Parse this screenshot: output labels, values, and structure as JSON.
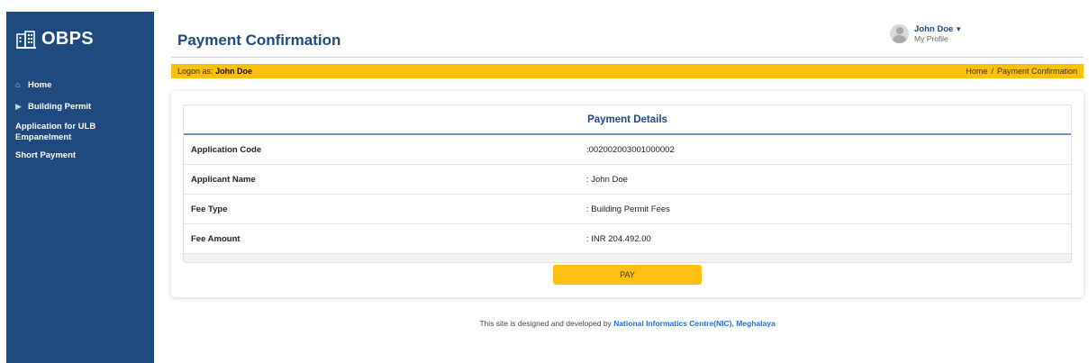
{
  "brand": {
    "name": "OBPS",
    "icon": "building-icon"
  },
  "sidebar": {
    "items": [
      {
        "label": "Home",
        "icon": "home-icon"
      },
      {
        "label": "Building Permit",
        "icon": "caret-right-icon"
      },
      {
        "label": "Application for ULB Empanelment"
      },
      {
        "label": "Short Payment"
      }
    ]
  },
  "header": {
    "title": "Payment Confirmation",
    "user_name": "John Doe",
    "profile_link": "My Profile"
  },
  "logon_bar": {
    "prefix": "Logon as:",
    "user": "John Doe",
    "breadcrumb": [
      "Home",
      "Payment Confirmation"
    ],
    "separator": "/"
  },
  "payment": {
    "heading": "Payment Details",
    "rows": [
      {
        "label": "Application Code",
        "value": ":002002003001000002"
      },
      {
        "label": "Applicant Name",
        "value": ": John Doe"
      },
      {
        "label": "Fee Type",
        "value": ": Building Permit Fees"
      },
      {
        "label": "Fee Amount",
        "value": ": INR 204.492.00"
      }
    ],
    "pay_label": "PAY"
  },
  "footer": {
    "text": "This site is designed and developed by",
    "link": "National Informatics Centre(NIC), Meghalaya"
  },
  "colors": {
    "sidebar_bg": "#1e4a80",
    "accent_yellow": "#fdc010",
    "title_blue": "#1d4a80",
    "link_blue": "#1d6fd6"
  }
}
